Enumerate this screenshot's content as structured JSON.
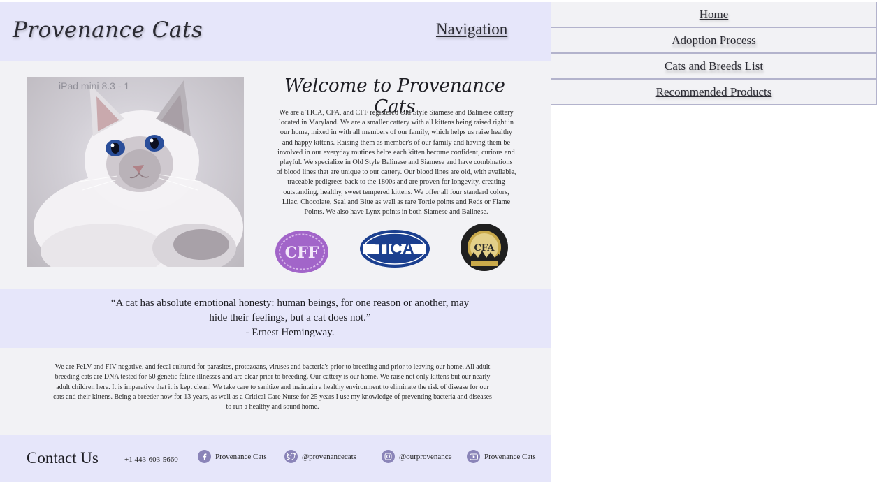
{
  "header": {
    "site_title": "Provenance Cats",
    "nav_label": "Navigation"
  },
  "side_menu": {
    "items": [
      {
        "label": "Home"
      },
      {
        "label": "Adoption Process"
      },
      {
        "label": "Cats and Breeds List"
      },
      {
        "label": "Recommended Products"
      }
    ]
  },
  "hero": {
    "overlay_caption": "iPad mini 8.3 - 1"
  },
  "welcome": {
    "title": "Welcome to Provenance Cats",
    "text": "We are a TICA, CFA, and CFF registered Old Style Siamese and Balinese cattery located in Maryland. We are a smaller cattery with all kittens being raised right in our home, mixed in with all members of our family, which helps us raise healthy and happy kittens. Raising them as member's of our family and having them be involved in our everyday routines helps each kitten become confident, curious and playful. We specialize in Old Style Balinese and Siamese and have combinations of blood lines that are unique to our cattery. Our blood lines are old, with available, traceable pedigrees back to the 1800s and are proven for longevity, creating outstanding, healthy, sweet tempered kittens.  We offer all four standard colors, Lilac, Chocolate, Seal and Blue as well as rare Tortie points and Reds or Flame Points.  We also have Lynx points in both Siamese and Balinese."
  },
  "logos": {
    "cff": "CFF",
    "tica": "TICA",
    "cfa_ring": "THE CAT FANCIERS' ASSOCIATION",
    "cfa_center": "CFA",
    "cfa_since": "SINCE 1906"
  },
  "quote": {
    "text": "“A cat has absolute emotional honesty: human beings, for one reason or another, may hide their feelings, but a cat does not.”",
    "author": "- Ernest Hemingway."
  },
  "health": {
    "text": "We are FeLV and FIV negative, and fecal cultured for parasites, protozoans, viruses and bacteria's prior to breeding and prior to leaving our home. All adult breeding cats are DNA tested for 50 genetic feline illnesses and are clear prior to breeding. Our cattery is our home. We raise not only kittens but our nearly adult children here. It is imperative that it is kept clean! We take care to sanitize and maintain a healthy environment to eliminate the risk of disease for our cats and their kittens. Being a breeder now for 13 years, as well as a Critical Care Nurse for 25 years I use my knowledge of preventing bacteria and diseases to run a healthy and sound home."
  },
  "footer": {
    "contact_title": "Contact Us",
    "phone": "+1 443-603-5660",
    "socials": [
      {
        "icon": "facebook-icon",
        "label": "Provenance Cats"
      },
      {
        "icon": "twitter-icon",
        "label": "@provenancecats"
      },
      {
        "icon": "instagram-icon",
        "label": "@ourprovenance"
      },
      {
        "icon": "youtube-icon",
        "label": "Provenance Cats"
      }
    ]
  },
  "colors": {
    "band": "#e6e6fa",
    "page": "#f2f2f5",
    "icon": "#8a84b8",
    "tica_blue": "#1b3f8f",
    "cff_purple": "#a265c9"
  }
}
